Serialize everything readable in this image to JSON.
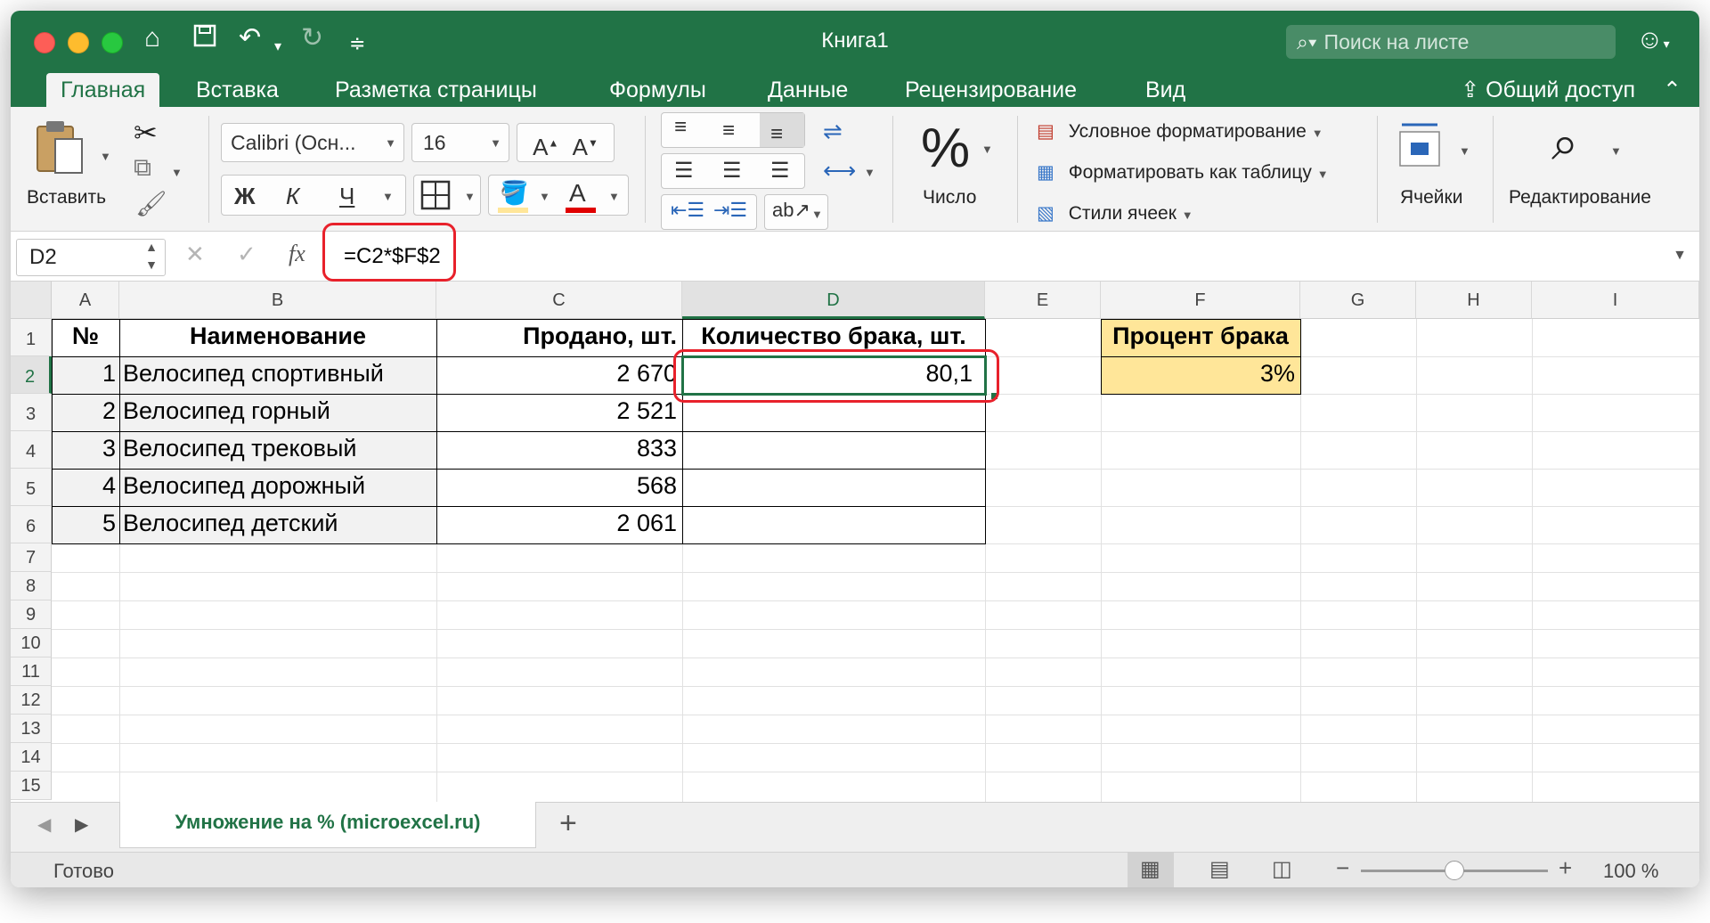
{
  "window": {
    "title": "Книга1"
  },
  "quick_access": {
    "home_icon": "home-icon",
    "save_icon": "save-icon",
    "undo_icon": "undo-icon",
    "redo_icon": "redo-icon",
    "more_icon": "customize-icon"
  },
  "search": {
    "placeholder": "Поиск на листе"
  },
  "tabs": [
    {
      "label": "Главная",
      "active": true
    },
    {
      "label": "Вставка"
    },
    {
      "label": "Разметка страницы"
    },
    {
      "label": "Формулы"
    },
    {
      "label": "Данные"
    },
    {
      "label": "Рецензирование"
    },
    {
      "label": "Вид"
    }
  ],
  "share_label": "Общий доступ",
  "ribbon": {
    "paste_label": "Вставить",
    "font_name": "Calibri (Осн...",
    "font_size": "16",
    "bold": "Ж",
    "italic": "К",
    "underline": "Ч",
    "number_label": "Число",
    "cond_format": "Условное форматирование",
    "format_table": "Форматировать как таблицу",
    "cell_styles": "Стили ячеек",
    "cells_label": "Ячейки",
    "editing_label": "Редактирование"
  },
  "formula_bar": {
    "name_box": "D2",
    "fx": "fx",
    "formula": "=C2*$F$2"
  },
  "columns": [
    "A",
    "B",
    "C",
    "D",
    "E",
    "F",
    "G",
    "H",
    "I"
  ],
  "rows": [
    "1",
    "2",
    "3",
    "4",
    "5",
    "6",
    "7",
    "8",
    "9",
    "10",
    "11",
    "12",
    "13",
    "14",
    "15"
  ],
  "table": {
    "headers": [
      "№",
      "Наименование",
      "Продано, шт.",
      "Количество брака, шт."
    ],
    "rows": [
      [
        "1",
        "Велосипед спортивный",
        "2 670",
        "80,1"
      ],
      [
        "2",
        "Велосипед горный",
        "2 521",
        ""
      ],
      [
        "3",
        "Велосипед трековый",
        "833",
        ""
      ],
      [
        "4",
        "Велосипед дорожный",
        "568",
        ""
      ],
      [
        "5",
        "Велосипед детский",
        "2 061",
        ""
      ]
    ]
  },
  "percent_block": {
    "label": "Процент брака",
    "value": "3%"
  },
  "sheet_tab": {
    "label": "Умножение на % (microexcel.ru)"
  },
  "status": {
    "text": "Готово",
    "zoom": "100 %"
  },
  "colors": {
    "accent": "#217346",
    "highlight": "#e8212b",
    "percent_fill": "#ffe699"
  }
}
